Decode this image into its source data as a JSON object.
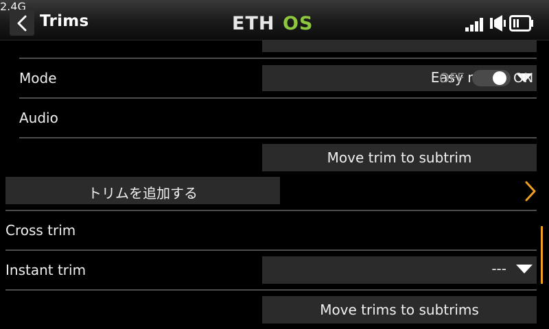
{
  "header": {
    "back_icon": "chevron-left-icon",
    "title": "Trims",
    "logo_text_main": "ETH",
    "logo_text_accent": "OS",
    "logo_accent_color": "#8dc63f",
    "signal_band": "2.4G",
    "icons": [
      "signal-strength-icon",
      "speaker-icon",
      "battery-icon"
    ]
  },
  "rows": {
    "partial_label": "",
    "mode": {
      "label": "Mode",
      "value": "Easy mode"
    },
    "audio": {
      "label": "Audio",
      "off_label": "OFF",
      "on_label": "ON",
      "state": "on"
    },
    "move_trim_button": "Move trim to subtrim",
    "add_trim_button": "トリムを追加する",
    "cross_trim": {
      "label": "Cross trim"
    },
    "instant_trim": {
      "label": "Instant trim",
      "value": "---"
    },
    "move_trims_button": "Move trims to subtrims"
  },
  "colors": {
    "accent": "#f0a020",
    "field_bg": "#2b2b2b",
    "background": "#000000"
  }
}
